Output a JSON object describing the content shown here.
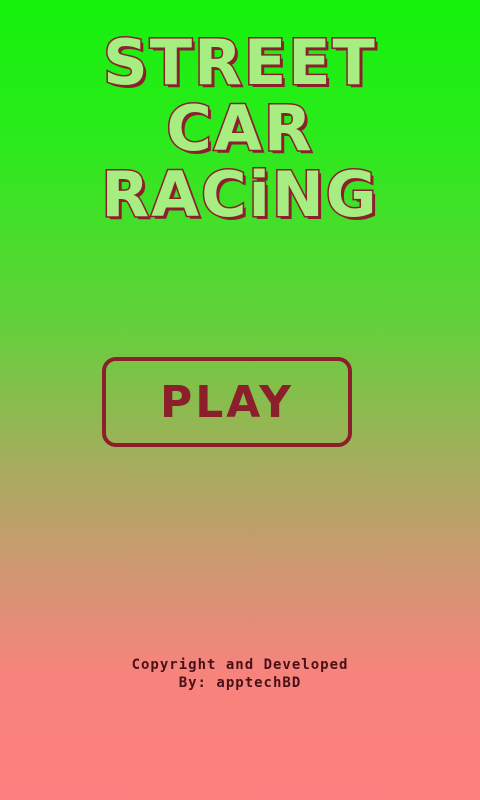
{
  "title": {
    "line1": "STREET",
    "line2": "CAR",
    "line3": "RACiNG"
  },
  "menu": {
    "play_label": "PLAY"
  },
  "credits": {
    "line1": "Copyright and Developed",
    "line2": "By: apptechBD"
  },
  "colors": {
    "background_top": "#15f20c",
    "background_bottom": "#ff7f7f",
    "accent": "#8c1f2c",
    "title_fill": "#a6ee81"
  }
}
